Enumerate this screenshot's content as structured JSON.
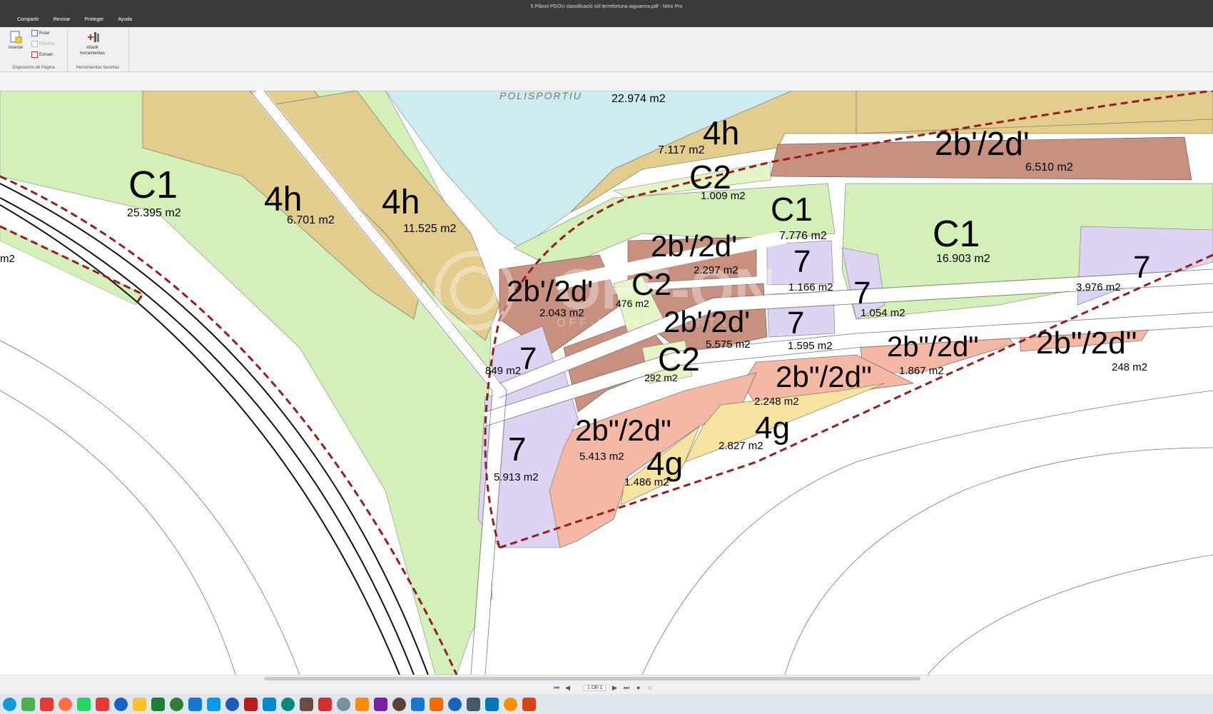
{
  "window": {
    "title": "5 Plànol PGOU classificació sòl terrefortuna aiguamra.pdf - Nitro Pro"
  },
  "menu": [
    "Compartir",
    "Revisar",
    "Proteger",
    "Ayuda"
  ],
  "ribbon": {
    "insertar": "Insertar",
    "rotar": "Rotar",
    "eliminar": "Eliminar",
    "extraer": "Extraer",
    "anadir_1": "Añadir",
    "anadir_2": "herramientas",
    "group_pagina": "Disposición de Página",
    "group_favoritas": "Herramientas favoritas"
  },
  "map": {
    "top_label": "POLISPORTIU",
    "watermark": {
      "brand": "OFF-ON",
      "tagline": "OFF-MARKET PORTAL"
    },
    "zones": [
      {
        "code": "C1",
        "area": "25.395 m2"
      },
      {
        "code": "4h",
        "area": "6.701 m2"
      },
      {
        "code": "4h",
        "area": "11.525 m2"
      },
      {
        "code": "",
        "area": "22.974 m2"
      },
      {
        "code": "4h",
        "area": "7.117 m2"
      },
      {
        "code": "2b'/2d'",
        "area": "6.510 m2"
      },
      {
        "code": "C2",
        "area": "1.009 m2"
      },
      {
        "code": "C1",
        "area": "7.776 m2"
      },
      {
        "code": "C1",
        "area": "16.903 m2"
      },
      {
        "code": "2b'/2d'",
        "area": "2.297 m2"
      },
      {
        "code": "7",
        "area": "1.166 m2"
      },
      {
        "code": "7",
        "area": "1.054 m2"
      },
      {
        "code": "7",
        "area": "3.976 m2"
      },
      {
        "code": "2b'/2d'",
        "area": "2.043 m2"
      },
      {
        "code": "C2",
        "area": "476 m2"
      },
      {
        "code": "2b'/2d'",
        "area": "5.575 m2"
      },
      {
        "code": "7",
        "area": "1.595 m2"
      },
      {
        "code": "2b\"/2d\"",
        "area": "1.867 m2"
      },
      {
        "code": "2b\"/2d\"",
        "area": "248 m2"
      },
      {
        "code": "7",
        "area": "849 m2"
      },
      {
        "code": "C2",
        "area": "292 m2"
      },
      {
        "code": "2b\"/2d\"",
        "area": "2.248 m2"
      },
      {
        "code": "2b\"/2d\"",
        "area": "5.413 m2"
      },
      {
        "code": "4g",
        "area": "2.827 m2"
      },
      {
        "code": "7",
        "area": "5.913 m2"
      },
      {
        "code": "4g",
        "area": "1.486 m2"
      },
      {
        "code": "",
        "area": "m2"
      }
    ]
  },
  "pagenav": {
    "indicator": "1 DE 1"
  },
  "taskbar": {
    "apps": [
      "edge-icon",
      "chrome-icon",
      "firefox-icon",
      "whatsapp-icon",
      "opera-icon",
      "outlook-icon",
      "explorer-icon",
      "excel-icon",
      "calculator-icon",
      "mail-icon",
      "skype-icon",
      "word-icon",
      "app-icon",
      "skype2-icon",
      "app2-icon",
      "photos-icon",
      "app3-icon",
      "app4-icon",
      "app5-icon",
      "app6-icon",
      "app7-icon",
      "app8-icon",
      "vlc-icon",
      "app9-icon",
      "paint-icon",
      "app10-icon",
      "app11-icon",
      "search-app-icon",
      "nitro-icon"
    ],
    "colors": [
      "#0f9bd7",
      "#4caf50",
      "#e53935",
      "#ff7043",
      "#25d366",
      "#e53935",
      "#1565c0",
      "#fbc02d",
      "#1e7e34",
      "#2e7d32",
      "#1976d2",
      "#039be5",
      "#1e5bb5",
      "#b71c1c",
      "#0288d1",
      "#00897b",
      "#6d4c41",
      "#d32f2f",
      "#78909c",
      "#fb8c00",
      "#7b1fa2",
      "#5d4037",
      "#1976d2",
      "#ef6c00",
      "#1565c0",
      "#455a64",
      "#0277bd",
      "#ff8f00",
      "#d84315"
    ]
  }
}
